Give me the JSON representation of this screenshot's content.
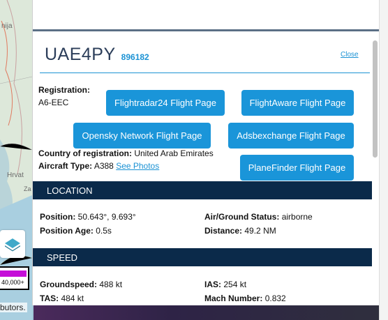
{
  "map": {
    "labels": {
      "nija": "nija",
      "hrvat": "Hrvat",
      "za": "Za"
    },
    "legend_value": "40,000+",
    "attribution": "butors."
  },
  "panel": {
    "callsign": "UAE4PY",
    "hex": "896182",
    "close_label": "Close",
    "registration_label": "Registration:",
    "registration_value": "A6-EEC",
    "buttons": {
      "fr24": "Flightradar24 Flight Page",
      "flightaware": "FlightAware Flight Page",
      "opensky": "Opensky Network Flight Page",
      "adsbexchange": "Adsbexchange Flight Page",
      "planefinder": "PlaneFinder Flight Page"
    },
    "country_label": "Country of registration:",
    "country_value": "United Arab Emirates",
    "aircraft_type_label": "Aircraft Type:",
    "aircraft_type_value": "A388",
    "see_photos": "See Photos",
    "location": {
      "title": "LOCATION",
      "position_label": "Position:",
      "position_value": "50.643°, 9.693°",
      "position_age_label": "Position Age:",
      "position_age_value": "0.5s",
      "air_ground_label": "Air/Ground Status:",
      "air_ground_value": "airborne",
      "distance_label": "Distance:",
      "distance_value": "49.2 NM"
    },
    "speed": {
      "title": "SPEED",
      "groundspeed_label": "Groundspeed:",
      "groundspeed_value": "488 kt",
      "tas_label": "TAS:",
      "tas_value": "484 kt",
      "ias_label": "IAS:",
      "ias_value": "254 kt",
      "mach_label": "Mach Number:",
      "mach_value": "0.832"
    }
  },
  "colors": {
    "accent": "#1a95d9",
    "section_bg": "#0b2a4a",
    "altitude_color": "#c50ed8"
  }
}
